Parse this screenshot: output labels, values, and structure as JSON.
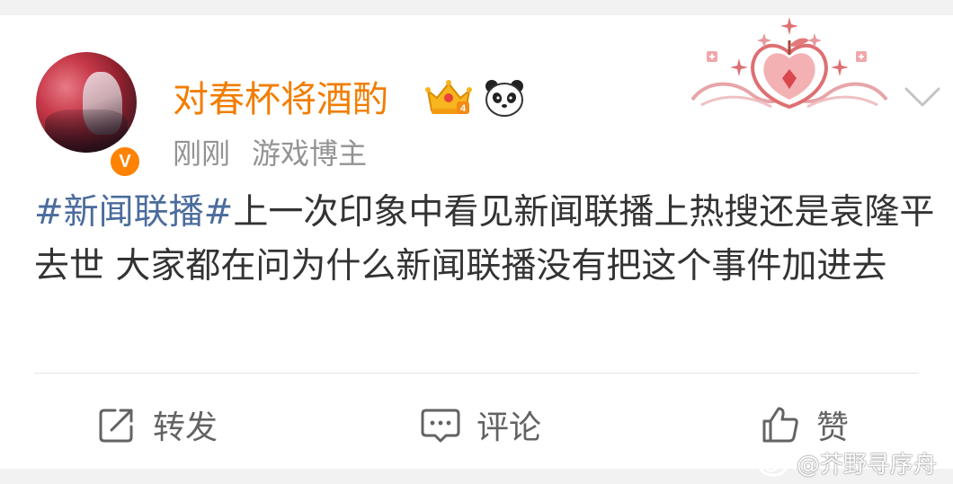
{
  "post": {
    "author": {
      "name": "对春杯将酒酌",
      "verified_mark": "V"
    },
    "meta": {
      "time": "刚刚",
      "tag": "游戏博主"
    },
    "content": {
      "hashtag": "#新闻联播#",
      "text": "上一次印象中看见新闻联播上热搜还是袁隆平去世 大家都在问为什么新闻联播没有把这个事件加进去"
    },
    "actions": {
      "repost_label": "转发",
      "comment_label": "评论",
      "like_label": "赞"
    }
  },
  "watermark": {
    "text": "@芥野寻序舟"
  },
  "icons": {
    "crown_badge": "crown-badge-icon",
    "panda_badge": "panda-badge-icon",
    "card_decoration": "strawberry-card-decoration",
    "more_menu": "chevron-down-icon",
    "repost": "share-arrow-icon",
    "comment": "comment-bubble-icon",
    "like": "thumbs-up-icon"
  },
  "colors": {
    "username": "#f27d00",
    "hashtag": "#4b6c9d",
    "body_text": "#333333",
    "meta_text": "#939393",
    "verified_badge": "#ff8200",
    "action_text": "#636363"
  }
}
